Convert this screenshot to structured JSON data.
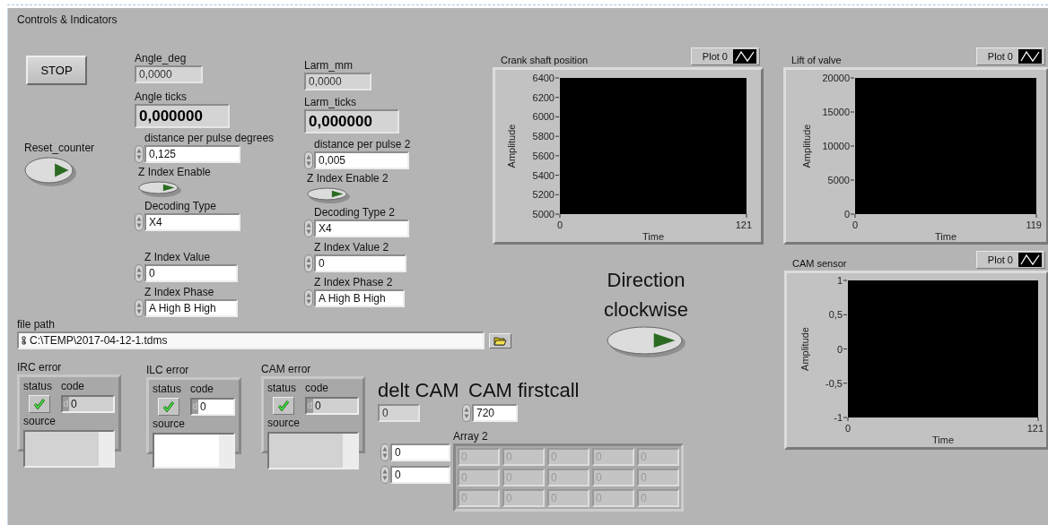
{
  "panel": {
    "title": "Controls & Indicators"
  },
  "controls": [
    {
      "kind": "button",
      "label": "STOP"
    },
    {
      "kind": "switch",
      "label": "Reset_counter",
      "on": false
    },
    {
      "kind": "indicator",
      "label": "Angle_deg",
      "value": "0,0000"
    },
    {
      "kind": "big_indicator",
      "label": "Angle ticks",
      "value": "0,000000"
    },
    {
      "kind": "control",
      "label": "distance per pulse degrees",
      "value": "0,125"
    },
    {
      "kind": "small_switch",
      "label": "Z Index Enable",
      "on": false
    },
    {
      "kind": "control",
      "label": "Decoding Type",
      "value": "X4"
    },
    {
      "kind": "control",
      "label": "Z Index Value",
      "value": "0"
    },
    {
      "kind": "control",
      "label": "Z Index Phase",
      "value": "A High B High"
    },
    {
      "kind": "indicator",
      "label": "Larm_mm",
      "value": "0,0000"
    },
    {
      "kind": "big_indicator",
      "label": "Larm_ticks",
      "value": "0,000000"
    },
    {
      "kind": "control",
      "label": "distance per pulse 2",
      "value": "0,005"
    },
    {
      "kind": "small_switch",
      "label": "Z Index Enable 2",
      "on": false
    },
    {
      "kind": "control",
      "label": "Decoding Type 2",
      "value": "X4"
    },
    {
      "kind": "control",
      "label": "Z Index Value 2",
      "value": "0"
    },
    {
      "kind": "control",
      "label": "Z Index Phase 2",
      "value": "A High B High"
    },
    {
      "kind": "big_switch",
      "label": "Direction clockwise",
      "on": false
    },
    {
      "kind": "path",
      "label": "file path",
      "value": "C:\\TEMP\\2017-04-12-1.tdms"
    },
    {
      "kind": "indicator",
      "label": "delt CAM",
      "value": "0",
      "large_label": true
    },
    {
      "kind": "control",
      "label": "CAM firstcall",
      "value": "720",
      "large_label": true
    }
  ],
  "graphs": [
    {
      "title": "Crank shaft position",
      "legend": "Plot 0",
      "chart_data": {
        "type": "line",
        "xlabel": "Time",
        "ylabel": "Amplitude",
        "xlim": [
          0,
          121
        ],
        "ylim": [
          5000,
          6400
        ],
        "xticks": [
          0,
          121
        ],
        "yticks": [
          5000,
          5200,
          5400,
          5600,
          5800,
          6000,
          6200,
          6400
        ]
      }
    },
    {
      "title": "Lift of valve",
      "legend": "Plot 0",
      "chart_data": {
        "type": "line",
        "xlabel": "Time",
        "ylabel": "Amplitude",
        "xlim": [
          0,
          119
        ],
        "ylim": [
          0,
          20000
        ],
        "xticks": [
          0,
          119
        ],
        "yticks": [
          0,
          5000,
          10000,
          15000,
          20000
        ]
      }
    },
    {
      "title": "CAM sensor",
      "legend": "Plot 0",
      "chart_data": {
        "type": "line",
        "xlabel": "Time",
        "ylabel": "Amplitude",
        "xlim": [
          0,
          121
        ],
        "ylim": [
          -1,
          1
        ],
        "xticks": [
          0,
          121
        ],
        "yticks": [
          -1,
          {
            "value": -0.5,
            "label": "-0,5"
          },
          0,
          {
            "value": 0.5,
            "label": "0,5"
          },
          1
        ]
      }
    }
  ],
  "errors": [
    {
      "label": "IRC error",
      "kind": "indicator",
      "status_label": "status",
      "status": true,
      "code_label": "code",
      "radix": "d",
      "code": "0",
      "source_label": "source"
    },
    {
      "label": "ILC error",
      "kind": "control",
      "status_label": "status",
      "status": true,
      "code_label": "code",
      "radix": "d",
      "code": "0",
      "source_label": "source"
    },
    {
      "label": "CAM error",
      "kind": "indicator",
      "status_label": "status",
      "status": true,
      "code_label": "code",
      "radix": "d",
      "code": "0",
      "source_label": "source"
    }
  ],
  "array": {
    "label": "Array 2",
    "disabled": true,
    "indices": [
      "0",
      "0"
    ],
    "rows": [
      [
        "0",
        "0",
        "0",
        "0",
        "0"
      ],
      [
        "0",
        "0",
        "0",
        "0",
        "0"
      ],
      [
        "0",
        "0",
        "0",
        "0",
        "0"
      ]
    ]
  }
}
